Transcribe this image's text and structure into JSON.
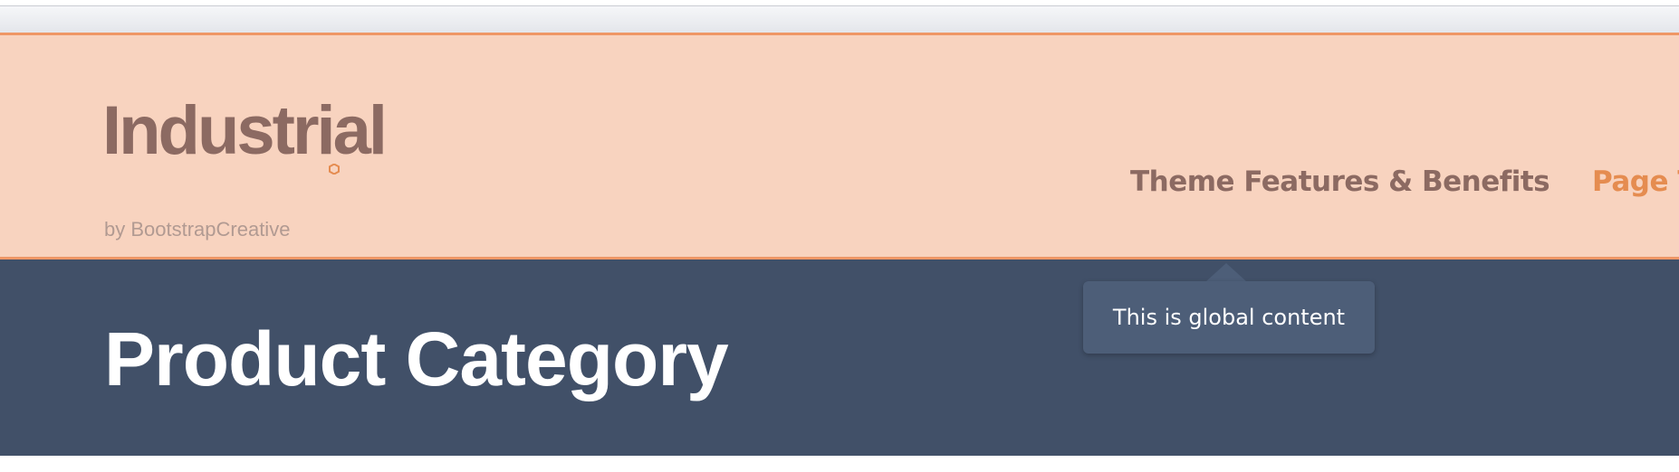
{
  "logo": {
    "name": "Industrial",
    "tagline": "by BootstrapCreative"
  },
  "nav": {
    "items": [
      {
        "label": "Theme Features & Benefits"
      },
      {
        "label": "Page T"
      }
    ]
  },
  "hero": {
    "title": "Product Category"
  },
  "tooltip": {
    "text": "This is global content"
  },
  "colors": {
    "header_bg": "#f8d3bf",
    "header_border": "#ef9766",
    "brand_text": "#8c6a62",
    "accent": "#e58c50",
    "hero_bg": "#415068",
    "tooltip_bg": "#4d5e78"
  }
}
